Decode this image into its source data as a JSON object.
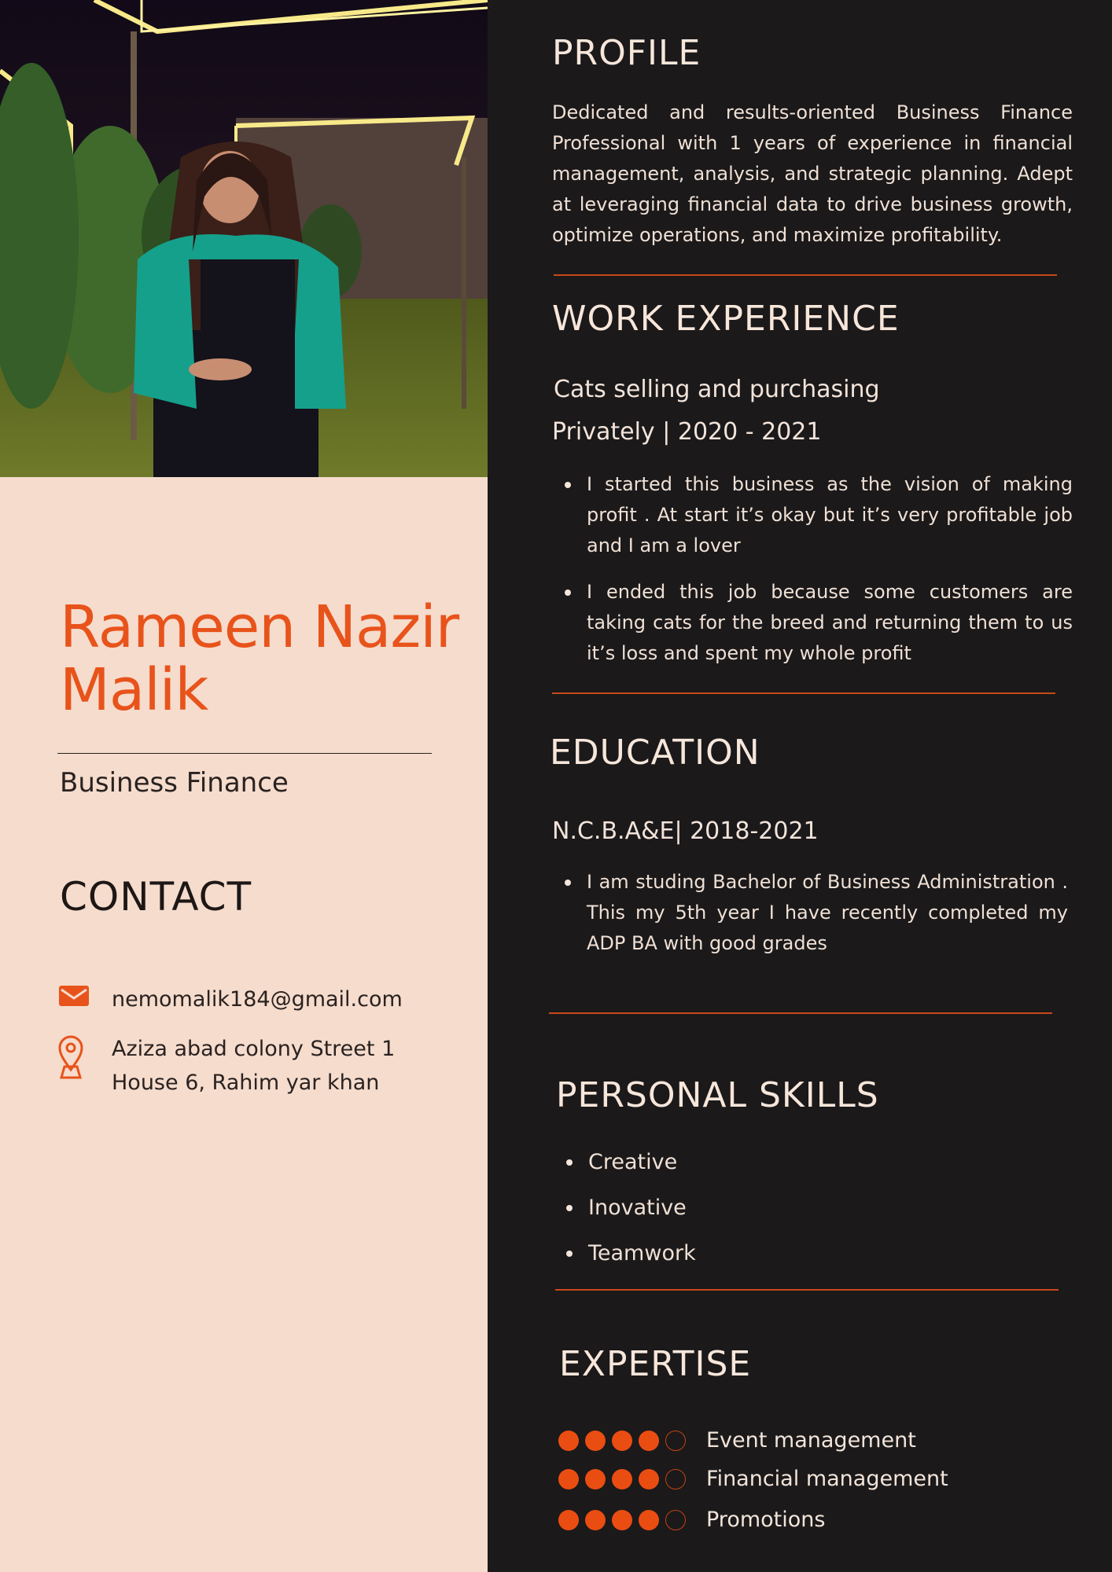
{
  "person": {
    "name_line1": "Rameen Nazir",
    "name_line2": "Malik",
    "title": "Business Finance"
  },
  "contact": {
    "heading": "CONTACT",
    "email": "nemomalik184@gmail.com",
    "address_line1": "Aziza abad colony Street 1",
    "address_line2": "House 6, Rahim yar khan"
  },
  "profile": {
    "heading": "PROFILE",
    "text": "Dedicated and results-oriented Business Finance Professional with 1 years of experience in financial management, analysis, and strategic planning. Adept at leveraging financial data to drive business growth, optimize operations, and maximize profitability."
  },
  "work": {
    "heading": "WORK EXPERIENCE",
    "role": "Cats selling and purchasing",
    "meta": "Privately | 2020 - 2021",
    "bullets": [
      "I started this business as the vision of making profit . At start it’s okay but it’s very profitable job and I am a lover",
      "I ended this job because some customers are taking cats for the breed and returning them to us it’s loss and spent my whole profit"
    ]
  },
  "education": {
    "heading": "EDUCATION",
    "school": "N.C.B.A&E| 2018-2021",
    "bullets": [
      "I am studing Bachelor of Business Administration . This my 5th year I have recently completed my ADP BA with good grades"
    ]
  },
  "skills": {
    "heading": "PERSONAL SKILLS",
    "items": [
      "Creative",
      "Inovative",
      "Teamwork"
    ]
  },
  "expertise": {
    "heading": "EXPERTISE",
    "items": [
      {
        "label": "Event management",
        "level": 4,
        "max": 5
      },
      {
        "label": "Financial management",
        "level": 4,
        "max": 5
      },
      {
        "label": "Promotions",
        "level": 4,
        "max": 5
      }
    ]
  },
  "colors": {
    "accent": "#e8531b",
    "left_bg": "#f5dccd",
    "right_bg": "#1b191a",
    "light_text": "#f5e6dc"
  },
  "icons": {
    "email": "envelope-icon",
    "address": "location-pin-icon"
  }
}
